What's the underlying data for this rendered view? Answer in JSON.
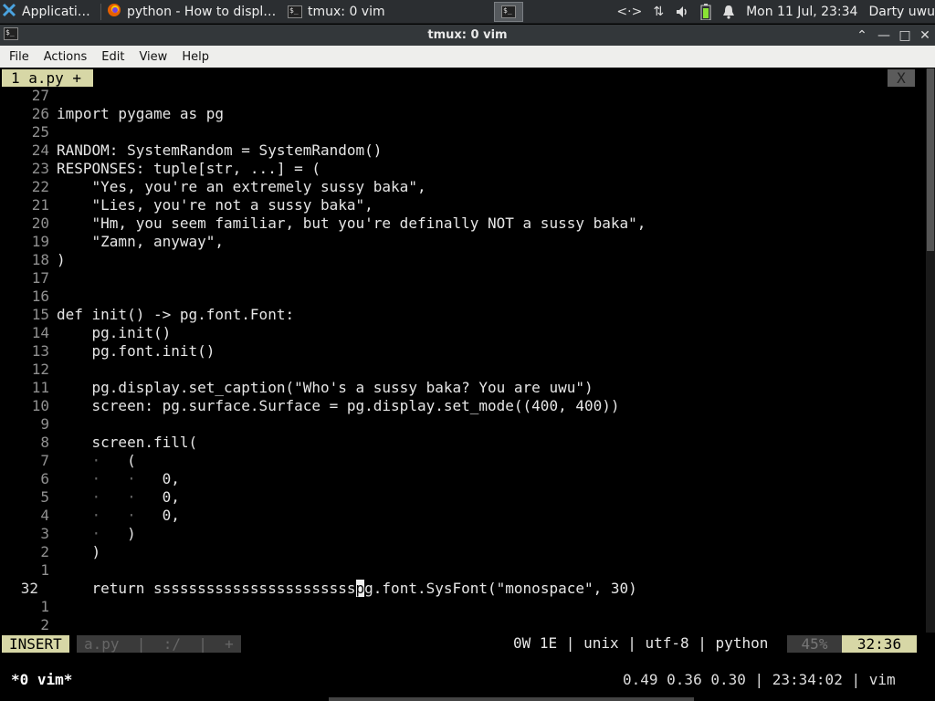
{
  "panel": {
    "apps_label": "Applications",
    "tasks": [
      {
        "label": "python - How to display…",
        "icon": "firefox-icon"
      },
      {
        "label": "tmux: 0 vim",
        "icon": "terminal-icon"
      }
    ],
    "tray": {
      "network_icon": "<·>",
      "transfer_icon": "⇅",
      "volume_icon": "🔈",
      "notify_icon": "🔔",
      "clock": "Mon 11 Jul, 23:34",
      "user": "Darty uwu"
    }
  },
  "window": {
    "title": "tmux: 0 vim",
    "controls": {
      "up": "⌃",
      "min": "—",
      "max": "□",
      "close": "✕"
    }
  },
  "menubar": {
    "items": [
      "File",
      "Actions",
      "Edit",
      "View",
      "Help"
    ]
  },
  "vim": {
    "tab_label": "1 a.py +",
    "tab_close": "X",
    "lines": [
      {
        "n": "27",
        "code": ""
      },
      {
        "n": "26",
        "code": "import pygame as pg"
      },
      {
        "n": "25",
        "code": ""
      },
      {
        "n": "24",
        "code": "RANDOM: SystemRandom = SystemRandom()"
      },
      {
        "n": "23",
        "code": "RESPONSES: tuple[str, ...] = ("
      },
      {
        "n": "22",
        "code": "    \"Yes, you're an extremely sussy baka\","
      },
      {
        "n": "21",
        "code": "    \"Lies, you're not a sussy baka\","
      },
      {
        "n": "20",
        "code": "    \"Hm, you seem familiar, but you're definally NOT a sussy baka\","
      },
      {
        "n": "19",
        "code": "    \"Zamn, anyway\","
      },
      {
        "n": "18",
        "code": ")"
      },
      {
        "n": "17",
        "code": ""
      },
      {
        "n": "16",
        "code": ""
      },
      {
        "n": "15",
        "code": "def init() -> pg.font.Font:"
      },
      {
        "n": "14",
        "code": "    pg.init()"
      },
      {
        "n": "13",
        "code": "    pg.font.init()"
      },
      {
        "n": "12",
        "code": ""
      },
      {
        "n": "11",
        "code": "    pg.display.set_caption(\"Who's a sussy baka? You are uwu\")"
      },
      {
        "n": "10",
        "code": "    screen: pg.surface.Surface = pg.display.set_mode((400, 400))"
      },
      {
        "n": "9",
        "code": ""
      },
      {
        "n": "8",
        "code": "    screen.fill("
      },
      {
        "n": "7",
        "code": "    ·   ("
      },
      {
        "n": "6",
        "code": "    ·   ·   0,"
      },
      {
        "n": "5",
        "code": "    ·   ·   0,"
      },
      {
        "n": "4",
        "code": "    ·   ·   0,"
      },
      {
        "n": "3",
        "code": "    ·   )"
      },
      {
        "n": "2",
        "code": "    )"
      },
      {
        "n": "1",
        "code": ""
      }
    ],
    "current_line": {
      "n": "32",
      "before": "    return sssssssssssssssssssssss",
      "cursor_char": "p",
      "after": "g.font.SysFont(\"monospace\", 30)"
    },
    "after_lines": [
      {
        "n": "1",
        "code": ""
      },
      {
        "n": "2",
        "code": ""
      }
    ],
    "status": {
      "mode": "INSERT",
      "file_segment": "a.py  |  :/  |  +",
      "right": "0W 1E | unix | utf-8 | python",
      "percent": "45%",
      "position": "32:36"
    }
  },
  "tmux": {
    "window": "*0 vim*",
    "right": "0.49 0.36 0.30 | 23:34:02 | vim"
  },
  "colors": {
    "accent": "#d7d7a6",
    "panel": "#2b2e31",
    "menubar": "#eeeeec"
  }
}
